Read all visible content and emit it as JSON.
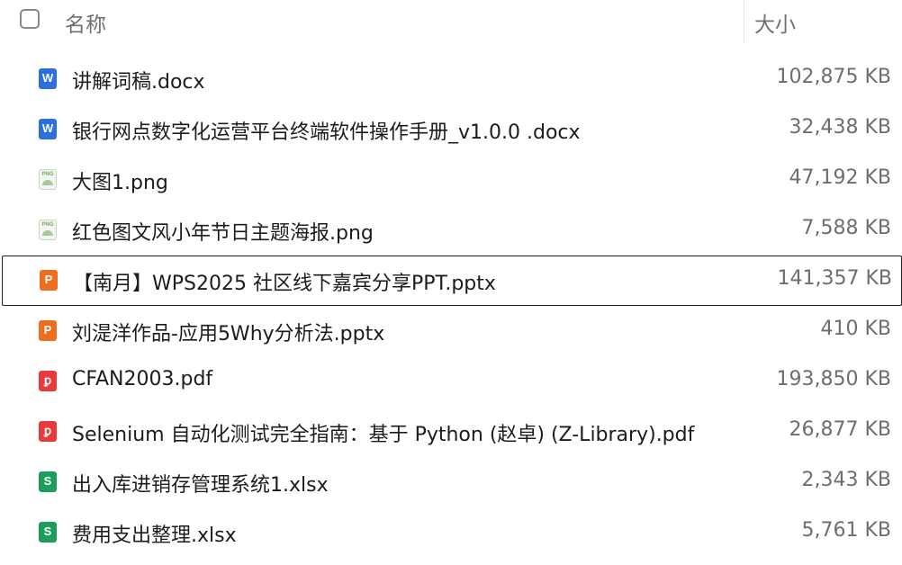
{
  "header": {
    "name_label": "名称",
    "size_label": "大小"
  },
  "files": [
    {
      "name": "讲解词稿.docx",
      "size": "102,875 KB",
      "type": "docx",
      "icon_glyph": "W",
      "icon": "word-doc-icon"
    },
    {
      "name": "银行网点数字化运营平台终端软件操作手册_v1.0.0 .docx",
      "size": "32,438 KB",
      "type": "docx",
      "icon_glyph": "W",
      "icon": "word-doc-icon"
    },
    {
      "name": "大图1.png",
      "size": "47,192 KB",
      "type": "png",
      "icon_glyph": "PNG",
      "icon": "png-image-icon"
    },
    {
      "name": "红色图文风小年节日主题海报.png",
      "size": "7,588 KB",
      "type": "png",
      "icon_glyph": "PNG",
      "icon": "png-image-icon"
    },
    {
      "name": "【南月】WPS2025 社区线下嘉宾分享PPT.pptx",
      "size": "141,357 KB",
      "type": "pptx",
      "icon_glyph": "P",
      "icon": "ppt-icon",
      "selected": true
    },
    {
      "name": "刘湜洋作品-应用5Why分析法.pptx",
      "size": "410 KB",
      "type": "pptx",
      "icon_glyph": "P",
      "icon": "ppt-icon"
    },
    {
      "name": "CFAN2003.pdf",
      "size": "193,850 KB",
      "type": "pdf",
      "icon_glyph": "ꝑ",
      "icon": "pdf-icon"
    },
    {
      "name": "Selenium 自动化测试完全指南：基于 Python (赵卓) (Z-Library).pdf",
      "size": "26,877 KB",
      "type": "pdf",
      "icon_glyph": "ꝑ",
      "icon": "pdf-icon"
    },
    {
      "name": "出入库进销存管理系统1.xlsx",
      "size": "2,343 KB",
      "type": "xlsx",
      "icon_glyph": "S",
      "icon": "spreadsheet-icon"
    },
    {
      "name": "费用支出整理.xlsx",
      "size": "5,761 KB",
      "type": "xlsx",
      "icon_glyph": "S",
      "icon": "spreadsheet-icon"
    }
  ]
}
